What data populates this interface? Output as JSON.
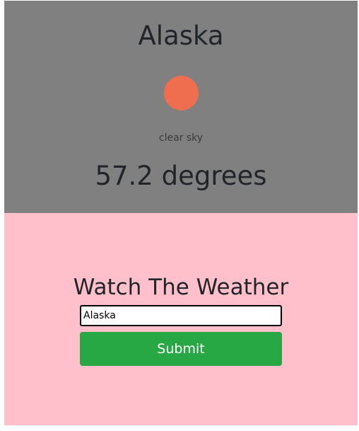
{
  "weather": {
    "city": "Alaska",
    "icon": "sun-icon",
    "icon_color": "#ee6e4f",
    "condition": "clear sky",
    "temperature": "57.2 degrees",
    "background_color": "#808080"
  },
  "form": {
    "title": "Watch The Weather",
    "city_input_value": "Alaska",
    "submit_label": "Submit",
    "background_color": "#ffc0cb",
    "button_color": "#28a745"
  }
}
